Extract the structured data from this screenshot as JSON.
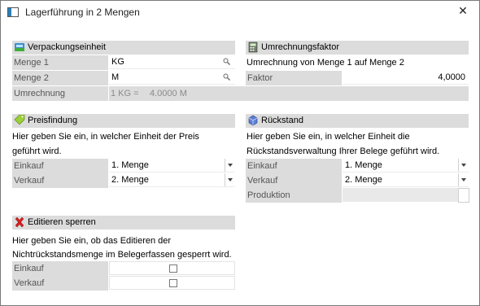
{
  "window": {
    "title": "Lagerführung in 2 Mengen",
    "close_glyph": "✕"
  },
  "verpackung": {
    "header": "Verpackungseinheit",
    "menge1_label": "Menge 1",
    "menge1_value": "KG",
    "menge2_label": "Menge 2",
    "menge2_value": "M",
    "umrechnung_label": "Umrechnung",
    "umrechnung_left": "1 KG =",
    "umrechnung_right": "4.0000 M"
  },
  "umrechnungsfaktor": {
    "header": "Umrechnungsfaktor",
    "description": "Umrechnung von Menge 1 auf Menge 2",
    "faktor_label": "Faktor",
    "faktor_value": "4,0000"
  },
  "preisfindung": {
    "header": "Preisfindung",
    "line1": "Hier geben Sie ein, in welcher Einheit der Preis",
    "line2": "geführt wird.",
    "einkauf_label": "Einkauf",
    "einkauf_value": "1. Menge",
    "verkauf_label": "Verkauf",
    "verkauf_value": "2. Menge"
  },
  "rueckstand": {
    "header": "Rückstand",
    "line1": "Hier geben Sie ein, in welcher Einheit die",
    "line2": "Rückstandsverwaltung Ihrer Belege geführt wird.",
    "einkauf_label": "Einkauf",
    "einkauf_value": "1. Menge",
    "verkauf_label": "Verkauf",
    "verkauf_value": "2. Menge",
    "produktion_label": "Produktion"
  },
  "editieren": {
    "header": "Editieren sperren",
    "line1": "Hier geben Sie ein, ob das Editieren der",
    "line2": "Nichtrückstandsmenge im Belegerfassen gesperrt wird.",
    "einkauf_label": "Einkauf",
    "einkauf_checked": false,
    "verkauf_label": "Verkauf",
    "verkauf_checked": false
  }
}
